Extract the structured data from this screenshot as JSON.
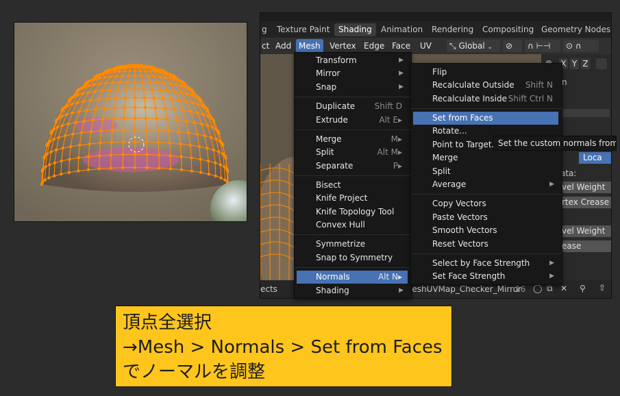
{
  "workspace_tabs": [
    "g",
    "Texture Paint",
    "Shading",
    "Animation",
    "Rendering",
    "Compositing",
    "Geometry Nodes"
  ],
  "header_menus": [
    "ct",
    "Add",
    "Mesh",
    "Vertex",
    "Edge",
    "Face",
    "UV"
  ],
  "header_controls": {
    "orientation": "Global",
    "axes": [
      "X",
      "Y",
      "Z"
    ]
  },
  "mesh_menu": [
    {
      "label": "Transform",
      "submenu": true
    },
    {
      "label": "Mirror",
      "submenu": true
    },
    {
      "label": "Snap",
      "submenu": true
    },
    {
      "label": "Duplicate",
      "shortcut": "Shift D"
    },
    {
      "label": "Extrude",
      "shortcut": "Alt E▸"
    },
    {
      "label": "Merge",
      "shortcut": "M▸"
    },
    {
      "label": "Split",
      "shortcut": "Alt M▸"
    },
    {
      "label": "Separate",
      "shortcut": "P▸"
    },
    {
      "label": "Bisect"
    },
    {
      "label": "Knife Project"
    },
    {
      "label": "Knife Topology Tool"
    },
    {
      "label": "Convex Hull"
    },
    {
      "label": "Symmetrize"
    },
    {
      "label": "Snap to Symmetry"
    },
    {
      "label": "Normals",
      "shortcut": "Alt N▸",
      "highlighted": true
    },
    {
      "label": "Shading",
      "submenu": true
    }
  ],
  "normals_menu": [
    {
      "label": "Flip"
    },
    {
      "label": "Recalculate Outside",
      "shortcut": "Shift N"
    },
    {
      "label": "Recalculate Inside",
      "shortcut": "Shift Ctrl N"
    },
    {
      "label": "Set from Faces",
      "highlighted": true
    },
    {
      "label": "Rotate..."
    },
    {
      "label": "Point to Target..."
    },
    {
      "label": "Merge"
    },
    {
      "label": "Split"
    },
    {
      "label": "Average",
      "submenu": true
    },
    {
      "label": "Copy Vectors"
    },
    {
      "label": "Paste Vectors"
    },
    {
      "label": "Smooth Vectors"
    },
    {
      "label": "Reset Vectors"
    },
    {
      "label": "Select by Face Strength",
      "submenu": true
    },
    {
      "label": "Set Face Strength",
      "submenu": true
    }
  ],
  "tooltip": "Set the custom normals from th",
  "properties_panel": {
    "tab": "Loca",
    "label_data": "ata:",
    "fields": [
      "vel Weight",
      "rtex Crease",
      "vel Weight",
      "ease"
    ],
    "colon": ":"
  },
  "footer": {
    "left": "ects",
    "material": "leshUVMap_Checker_Mirror",
    "users": "16"
  },
  "note_lines": [
    "頂点全選択",
    "→Mesh > Normals > Set from Faces",
    "でノーマルを調整"
  ],
  "colors": {
    "accent": "#4772b3",
    "note_bg": "#fec51d",
    "vertex": "#ff8a00"
  }
}
